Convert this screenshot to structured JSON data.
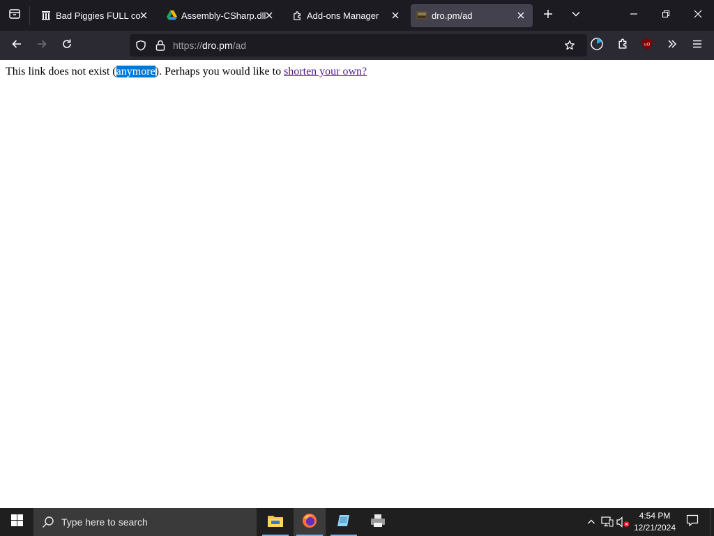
{
  "browser": {
    "tabs": [
      {
        "title": "Bad Piggies FULL colle",
        "icon": "library-icon",
        "active": false
      },
      {
        "title": "Assembly-CSharp.dll -",
        "icon": "google-drive-icon",
        "active": false
      },
      {
        "title": "Add-ons Manager",
        "icon": "puzzle-piece-icon",
        "active": false
      },
      {
        "title": "dro.pm/ad",
        "icon": "site-favicon",
        "active": true
      }
    ],
    "url": {
      "scheme": "https://",
      "host": "dro.pm",
      "path": "/ad"
    },
    "colors": {
      "tabstrip": "#1c1b22",
      "toolbar": "#2b2a33",
      "active_tab": "#42414d",
      "urlbar": "#1c1b22"
    }
  },
  "page": {
    "text_before": "This link does not exist (",
    "selected_word": "anymore",
    "text_after": "). Perhaps you would like to ",
    "link_text": "shorten your own?",
    "colors": {
      "selection": "#0078d7",
      "visited_link": "#551a8b"
    }
  },
  "taskbar": {
    "search_placeholder": "Type here to search",
    "apps": [
      "file-explorer-icon",
      "firefox-icon",
      "notepad-icon",
      "printer-icon"
    ],
    "clock": {
      "time": "4:54 PM",
      "date": "12/21/2024"
    }
  }
}
